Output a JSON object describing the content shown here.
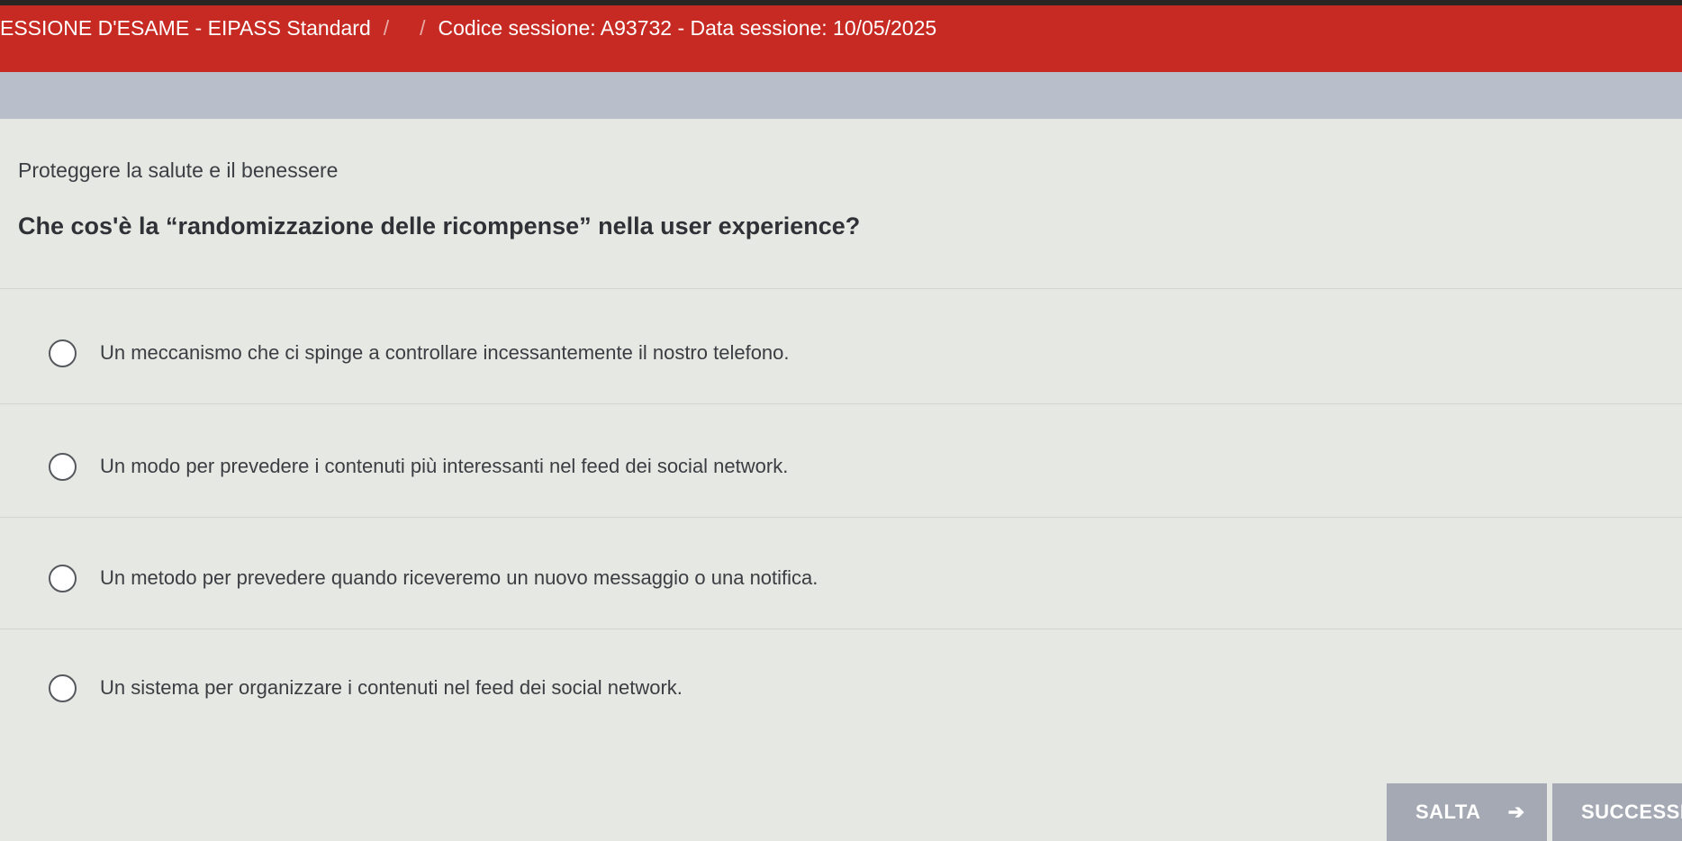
{
  "header": {
    "exam_title": "ESSIONE D'ESAME - EIPASS Standard",
    "separator_1": "/",
    "separator_2": "/",
    "session_info": "Codice sessione: A93732 - Data sessione: 10/05/2025"
  },
  "main": {
    "category": "Proteggere la salute e il benessere",
    "question": "Che cos'è la “randomizzazione delle ricompense” nella user experience?",
    "options": [
      "Un meccanismo che ci spinge a controllare incessantemente il nostro telefono.",
      "Un modo per prevedere i contenuti più interessanti nel feed dei social network.",
      "Un metodo per prevedere quando riceveremo un nuovo messaggio o una notifica.",
      "Un sistema per organizzare i contenuti nel feed dei social network."
    ]
  },
  "footer": {
    "skip_label": "SALTA",
    "skip_icon": "arrow-right-icon",
    "next_label": "SUCCESSI"
  },
  "colors": {
    "header_bg": "#c72a22",
    "subheader_bg": "#b9bfca",
    "content_bg": "#e6e9e3",
    "button_bg": "#a4a9b4"
  }
}
